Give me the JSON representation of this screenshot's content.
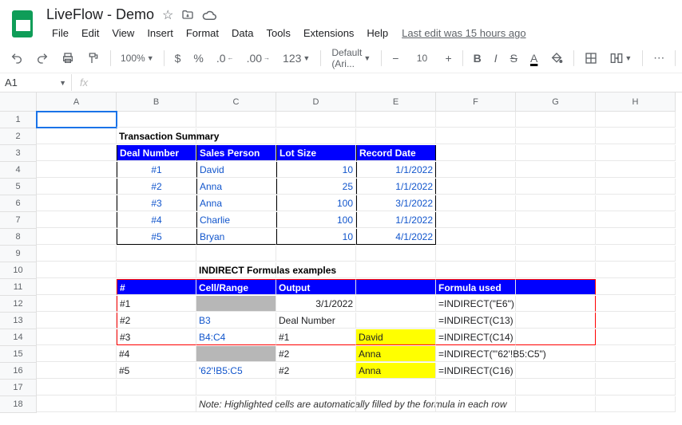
{
  "docname": "LiveFlow - Demo",
  "lastedit": "Last edit was 15 hours ago",
  "menus": [
    "File",
    "Edit",
    "View",
    "Insert",
    "Format",
    "Data",
    "Tools",
    "Extensions",
    "Help"
  ],
  "toolbar": {
    "zoom": "100%",
    "font": "Default (Ari...",
    "size": "10"
  },
  "namebox": "A1",
  "colwidths": {
    "A": 100,
    "B": 100,
    "C": 100,
    "D": 100,
    "E": 100,
    "F": 100,
    "G": 100,
    "H": 100
  },
  "cols": [
    "A",
    "B",
    "C",
    "D",
    "E",
    "F",
    "G",
    "H"
  ],
  "rownums": [
    1,
    2,
    3,
    4,
    5,
    6,
    7,
    8,
    9,
    10,
    11,
    12,
    13,
    14,
    15,
    16,
    17,
    18
  ],
  "content": {
    "B2": "Transaction Summary",
    "B3": "Deal Number",
    "C3": "Sales Person",
    "D3": "Lot Size",
    "E3": "Record Date",
    "B4": "#1",
    "C4": "David",
    "D4": "10",
    "E4": "1/1/2022",
    "B5": "#2",
    "C5": "Anna",
    "D5": "25",
    "E5": "1/1/2022",
    "B6": "#3",
    "C6": "Anna",
    "D6": "100",
    "E6": "3/1/2022",
    "B7": "#4",
    "C7": "Charlie",
    "D7": "100",
    "E7": "1/1/2022",
    "B8": "#5",
    "C8": "Bryan",
    "D8": "10",
    "E8": "4/1/2022",
    "C10": "INDIRECT Formulas examples",
    "B11": "#",
    "C11": "Cell/Range",
    "D11": "Output",
    "F11": "Formula used",
    "B12": "#1",
    "D12": "3/1/2022",
    "F12": "=INDIRECT(\"E6\")",
    "B13": "#2",
    "C13": "B3",
    "D13": "Deal Number",
    "F13": "=INDIRECT(C13)",
    "B14": "#3",
    "C14": "B4:C4",
    "D14": "#1",
    "E14": "David",
    "F14": "=INDIRECT(C14)",
    "B15": "#4",
    "D15": "#2",
    "E15": "Anna",
    "F15": "=INDIRECT(\"'62'!B5:C5\")",
    "B16": "#5",
    "C16": "'62'!B5:C5",
    "D16": "#2",
    "E16": "Anna",
    "F16": "=INDIRECT(C16)",
    "C18": "Note: Highlighted cells are automatically filled by the formula in each row"
  }
}
